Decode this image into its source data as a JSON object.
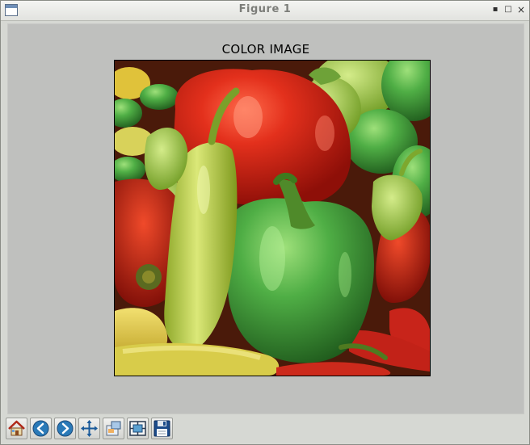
{
  "window": {
    "title": "Figure 1",
    "min_glyph": "▪",
    "max_glyph": "□",
    "close_glyph": "×"
  },
  "figure": {
    "title": "COLOR IMAGE",
    "image_subject": "peppers-photo"
  },
  "toolbar": {
    "buttons": [
      {
        "name": "home-button",
        "icon": "home-icon"
      },
      {
        "name": "back-button",
        "icon": "back-arrow-icon"
      },
      {
        "name": "forward-button",
        "icon": "forward-arrow-icon"
      },
      {
        "name": "pan-button",
        "icon": "pan-arrows-icon"
      },
      {
        "name": "zoom-button",
        "icon": "zoom-rect-icon"
      },
      {
        "name": "configure-subplots-button",
        "icon": "subplots-icon"
      },
      {
        "name": "save-button",
        "icon": "floppy-disk-icon"
      }
    ]
  },
  "colors": {
    "canvas_bg": "#bfc0be",
    "window_bg": "#d6d8d3",
    "pepper_red": "#d8281a",
    "pepper_green": "#46a640",
    "pepper_yellow_green": "#b8cc3a"
  }
}
